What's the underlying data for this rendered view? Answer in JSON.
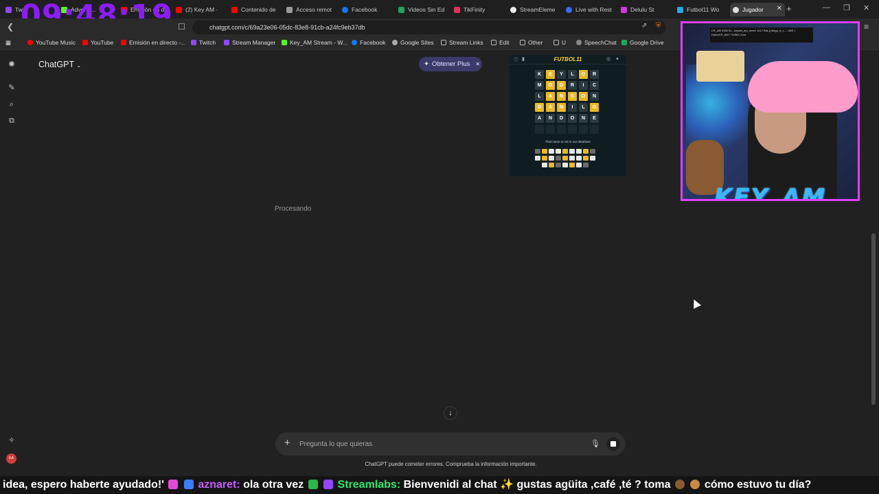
{
  "browser": {
    "tabs": [
      {
        "label": "Tw..."
      },
      {
        "label": "Adverte..."
      },
      {
        "label": "Emisión en di"
      },
      {
        "label": "(2) Key AM ·"
      },
      {
        "label": "Contenido de"
      },
      {
        "label": "Acceso remot"
      },
      {
        "label": "Facebook"
      },
      {
        "label": "Videos Sin Ed"
      },
      {
        "label": "TikFinity"
      },
      {
        "label": "StreamEleme"
      },
      {
        "label": "Live with Rest"
      },
      {
        "label": "Delulu St"
      },
      {
        "label": "Futbol11 Wo"
      },
      {
        "label": "Jugador"
      }
    ],
    "url": "chatgpt.com/c/69a23e06-05dc-83e8-91cb-a24fc9eb37db",
    "bookmarks": [
      {
        "label": "YouTube Music",
        "color": "#ff0000"
      },
      {
        "label": "YouTube",
        "color": "#ff0000"
      },
      {
        "label": "Emisión en directo -...",
        "color": "#ff0000"
      },
      {
        "label": "Twitch",
        "color": "#9146ff"
      },
      {
        "label": "Stream Manager",
        "color": "#9146ff"
      },
      {
        "label": "Key_AM Stream - W...",
        "color": "#53fc18"
      },
      {
        "label": "Facebook",
        "color": "#1877f2"
      },
      {
        "label": "Google Sites",
        "color": "#aaaaaa"
      },
      {
        "label": "Stream Links",
        "color": "#888888"
      },
      {
        "label": "Edit",
        "color": "#888888"
      },
      {
        "label": "Other",
        "color": "#888888"
      },
      {
        "label": "U",
        "color": "#888888"
      },
      {
        "label": "SpeechChat",
        "color": "#888888"
      },
      {
        "label": "Google Drive",
        "color": "#1fa463"
      }
    ]
  },
  "overlay": {
    "clock": "09:48:19",
    "webcam_name": "KEY_AM",
    "cam_header": "CR_AM 5300 Bi... keyam_am_meet: 1417 Bits || diego_d_o ... UBS | DarkoCR_AM 7 SUBS | Dvd"
  },
  "chatgpt": {
    "title": "ChatGPT",
    "plus_button": "Obtener Plus",
    "status": "Procesando",
    "composer_placeholder": "Pregunta lo que quieras",
    "disclaimer": "ChatGPT puede cometer errores. Comprueba la información importante.",
    "avatar_initials": "KA"
  },
  "futbol": {
    "title": "FUTBOL11",
    "note": "That name is not in our database",
    "rows": [
      {
        "letters": [
          "K",
          "E",
          "Y",
          "L",
          "O",
          "R"
        ],
        "states": [
          "g",
          "y",
          "g",
          "g",
          "y",
          "g"
        ]
      },
      {
        "letters": [
          "M",
          "O",
          "D",
          "R",
          "I",
          "C"
        ],
        "states": [
          "g",
          "y",
          "y",
          "g",
          "g",
          "g"
        ]
      },
      {
        "letters": [
          "L",
          "A",
          "N",
          "G",
          "O",
          "N"
        ],
        "states": [
          "g",
          "y",
          "y",
          "y",
          "y",
          "g"
        ]
      },
      {
        "letters": [
          "D",
          "A",
          "N",
          "I",
          "L",
          "O"
        ],
        "states": [
          "y",
          "y",
          "y",
          "g",
          "g",
          "y"
        ]
      },
      {
        "letters": [
          "A",
          "N",
          "D",
          "O",
          "N",
          "E"
        ],
        "states": [
          "g",
          "g",
          "g",
          "g",
          "g",
          "g"
        ]
      },
      {
        "letters": [
          "",
          "",
          "",
          "",
          "",
          ""
        ],
        "states": [
          "e",
          "e",
          "e",
          "e",
          "e",
          "e"
        ]
      }
    ]
  },
  "ticker": {
    "text_1": "idea, espero haberte ayudado!'",
    "user_1": "aznaret:",
    "text_2": "ola otra vez",
    "user_2": "Streamlabs:",
    "text_3": "Bienvenidi al chat ✨ gustas agüita ,café ,té ? toma",
    "text_4": "cómo estuvo tu día?"
  }
}
